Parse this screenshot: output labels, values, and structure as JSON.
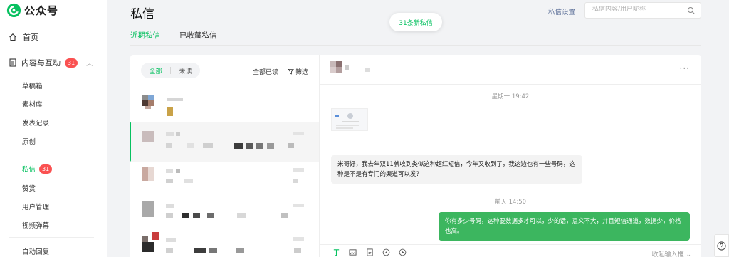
{
  "app": {
    "name": "公众号"
  },
  "sidebar": {
    "home": "首页",
    "content_group": {
      "label": "内容与互动",
      "badge": "31"
    },
    "content_items": [
      {
        "label": "草稿箱"
      },
      {
        "label": "素材库"
      },
      {
        "label": "发表记录"
      },
      {
        "label": "原创"
      }
    ],
    "interact_items": [
      {
        "label": "私信",
        "badge": "31",
        "active": true
      },
      {
        "label": "赞赏"
      },
      {
        "label": "用户管理"
      },
      {
        "label": "视频弹幕"
      }
    ],
    "auto_reply": "自动回复"
  },
  "header": {
    "title": "私信",
    "settings": "私信设置",
    "search_placeholder": "私信内容/用户昵称",
    "new_messages": "31条新私信"
  },
  "tabs": [
    {
      "label": "近期私信",
      "active": true
    },
    {
      "label": "已收藏私信",
      "active": false
    }
  ],
  "list": {
    "filter_all": "全部",
    "filter_unread": "未读",
    "mark_all_read": "全部已读",
    "filter": "筛选"
  },
  "chat": {
    "ts1": "星期一 19:42",
    "incoming": "米哥好，我去年双11就收到类似这种超红短信，今年又收到了，我这边也有一些号码，这种是不是有专门的渠道可以发?",
    "ts2": "前天 14:50",
    "outgoing": "你有多少号码，这种要数据多才可以，少的话，意义不大，并且短信通道，数据少，价格也高。",
    "collapse_input": "收起输入框"
  },
  "colors": {
    "accent": "#07c160",
    "badge": "#fa5151",
    "link": "#576b95",
    "bubble_out": "#3cb65f"
  }
}
